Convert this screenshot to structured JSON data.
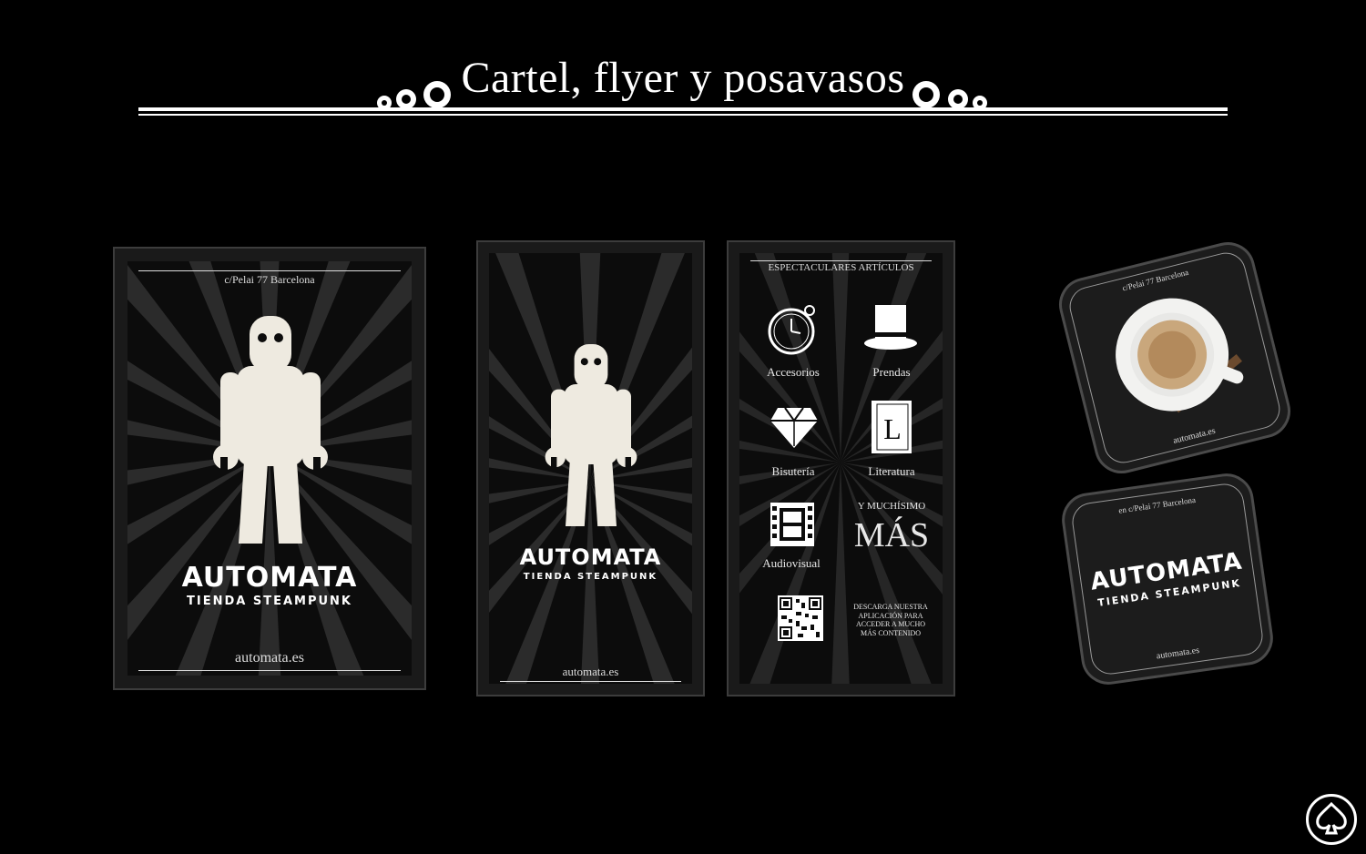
{
  "title": "Cartel, flyer y posavasos",
  "poster": {
    "address": "c/Pelai 77 Barcelona",
    "brand": "AUTOMATA",
    "subtitle": "TIENDA STEAMPUNK",
    "url": "automata.es"
  },
  "flyer_front": {
    "brand": "AUTOMATA",
    "subtitle": "TIENDA STEAMPUNK",
    "url": "automata.es"
  },
  "flyer_back": {
    "heading": "ESPECTACULARES ARTÍCULOS",
    "categories": [
      {
        "label": "Accesorios",
        "icon": "pocket-watch-icon"
      },
      {
        "label": "Prendas",
        "icon": "top-hat-icon"
      },
      {
        "label": "Bisutería",
        "icon": "diamond-icon"
      },
      {
        "label": "Literatura",
        "icon": "book-icon"
      },
      {
        "label": "Audiovisual",
        "icon": "film-strip-icon"
      }
    ],
    "more_small": "Y MUCHÍSIMO",
    "more_big": "MÁS",
    "download_lines": [
      "DESCARGA NUESTRA",
      "APLICACIÓN PARA",
      "ACCEDER A MUCHO",
      "MÁS CONTENIDO"
    ]
  },
  "coaster_top": {
    "address": "c/Pelai 77 Barcelona",
    "url": "automata.es"
  },
  "coaster_bottom": {
    "address": "en c/Pelai 77 Barcelona",
    "brand": "AUTOMATA",
    "subtitle": "TIENDA STEAMPUNK",
    "url": "automata.es"
  },
  "colors": {
    "background": "#000000",
    "panel": "#1a1a1a",
    "border": "#3c3c3c",
    "text": "#ffffff"
  }
}
